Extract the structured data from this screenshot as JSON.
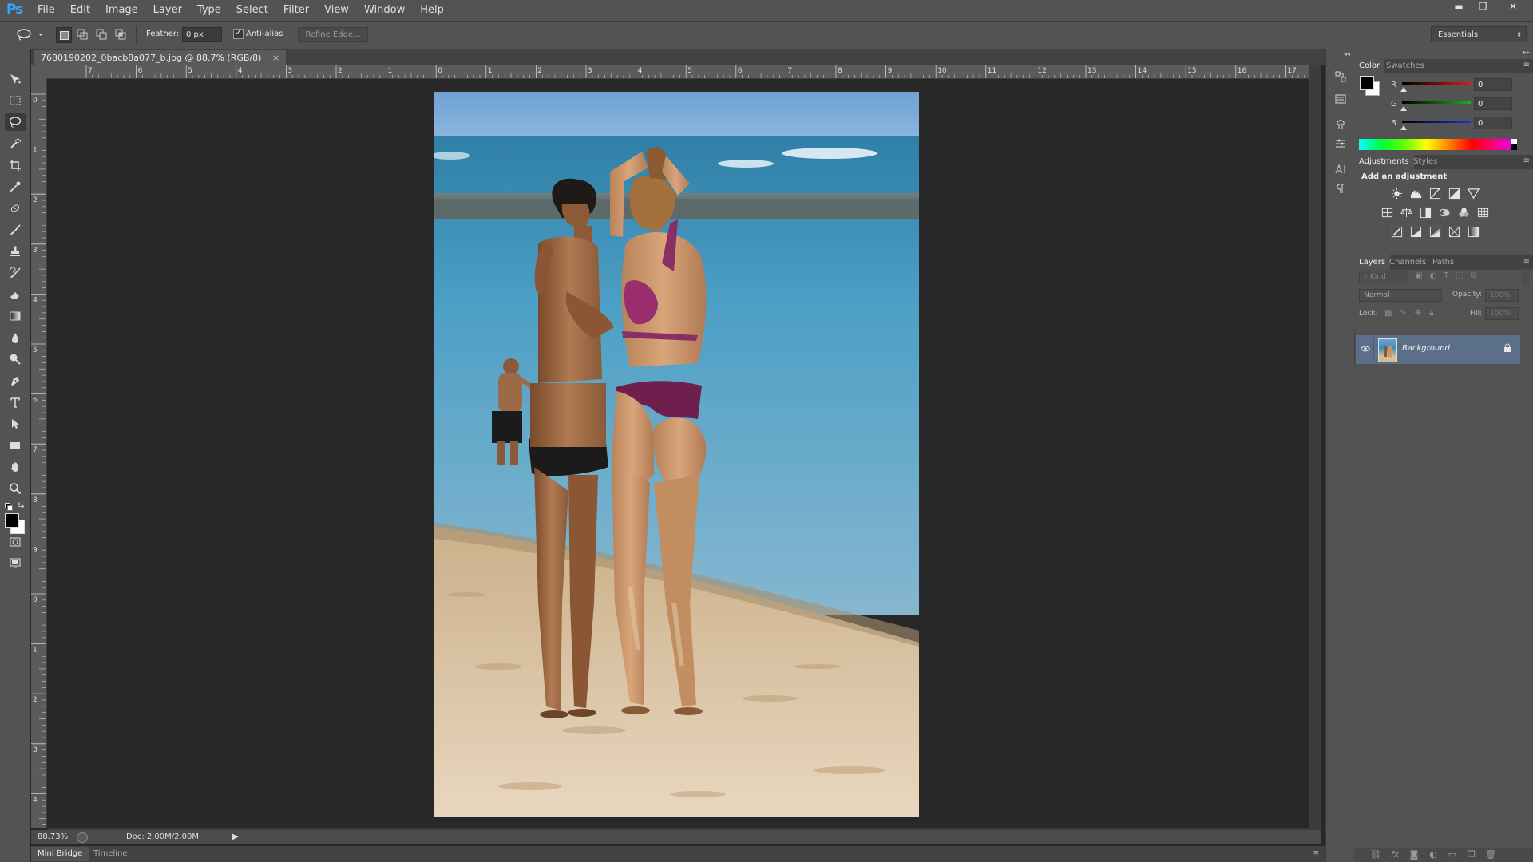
{
  "app": {
    "logo": "Ps"
  },
  "menu": {
    "items": [
      "File",
      "Edit",
      "Image",
      "Layer",
      "Type",
      "Select",
      "Filter",
      "View",
      "Window",
      "Help"
    ]
  },
  "window_controls": {
    "minimize": "▬",
    "restore": "❐",
    "close": "✕"
  },
  "options_bar": {
    "feather_label": "Feather:",
    "feather_value": "0 px",
    "antialias_label": "Anti-alias",
    "antialias_checked": true,
    "refine_edge_label": "Refine Edge...",
    "workspace": "Essentials"
  },
  "toolbar": {
    "tools": [
      "move-tool",
      "rectangular-marquee-tool",
      "lasso-tool",
      "quick-selection-tool",
      "crop-tool",
      "eyedropper-tool",
      "spot-healing-brush-tool",
      "brush-tool",
      "clone-stamp-tool",
      "history-brush-tool",
      "eraser-tool",
      "gradient-tool",
      "blur-tool",
      "dodge-tool",
      "pen-tool",
      "type-tool",
      "path-selection-tool",
      "rectangle-tool",
      "hand-tool",
      "zoom-tool"
    ],
    "active_tool": "lasso-tool",
    "foreground_color": "#000000",
    "background_color": "#ffffff"
  },
  "document": {
    "tab_title": "7680190202_0bacb8a077_b.jpg @ 88.7% (RGB/8)",
    "tab_close": "×",
    "ruler_h_labels": [
      "7",
      "6",
      "5",
      "4",
      "3",
      "2",
      "1",
      "0",
      "1",
      "2",
      "3",
      "4",
      "5",
      "6",
      "7",
      "8",
      "9",
      "10",
      "11",
      "12",
      "13",
      "14",
      "15",
      "16",
      "17"
    ],
    "ruler_v_labels": [
      "0",
      "1",
      "2",
      "3",
      "4",
      "5",
      "6",
      "7",
      "8",
      "9",
      "0",
      "1",
      "2",
      "3",
      "4"
    ]
  },
  "status": {
    "zoom": "88.73%",
    "doc_size": "Doc: 2.00M/2.00M"
  },
  "bottom_tabs": [
    "Mini Bridge",
    "Timeline"
  ],
  "color_panel": {
    "tabs": [
      "Color",
      "Swatches"
    ],
    "channels": [
      {
        "label": "R",
        "value": "0",
        "color": "#e01818"
      },
      {
        "label": "G",
        "value": "0",
        "color": "#19b019"
      },
      {
        "label": "B",
        "value": "0",
        "color": "#1a2fd8"
      }
    ]
  },
  "adjustments_panel": {
    "tabs": [
      "Adjustments",
      "Styles"
    ],
    "title": "Add an adjustment",
    "rows": [
      [
        "brightness-contrast-icon",
        "levels-icon",
        "curves-icon",
        "exposure-icon",
        "gradient-triangle-icon"
      ],
      [
        "vibrance-icon",
        "color-balance-icon",
        "black-white-icon",
        "photo-filter-icon",
        "channel-mixer-icon",
        "color-lookup-icon"
      ],
      [
        "invert-icon",
        "posterize-icon",
        "threshold-icon",
        "selective-color-icon",
        "gradient-map-icon"
      ]
    ]
  },
  "layers_panel": {
    "tabs": [
      "Layers",
      "Channels",
      "Paths"
    ],
    "filter_kind": "Kind",
    "blend_mode": "Normal",
    "opacity_label": "Opacity:",
    "opacity_value": "100%",
    "lock_label": "Lock:",
    "fill_label": "Fill:",
    "fill_value": "100%",
    "layers": [
      {
        "name": "Background",
        "visible": true,
        "locked": true
      }
    ]
  }
}
